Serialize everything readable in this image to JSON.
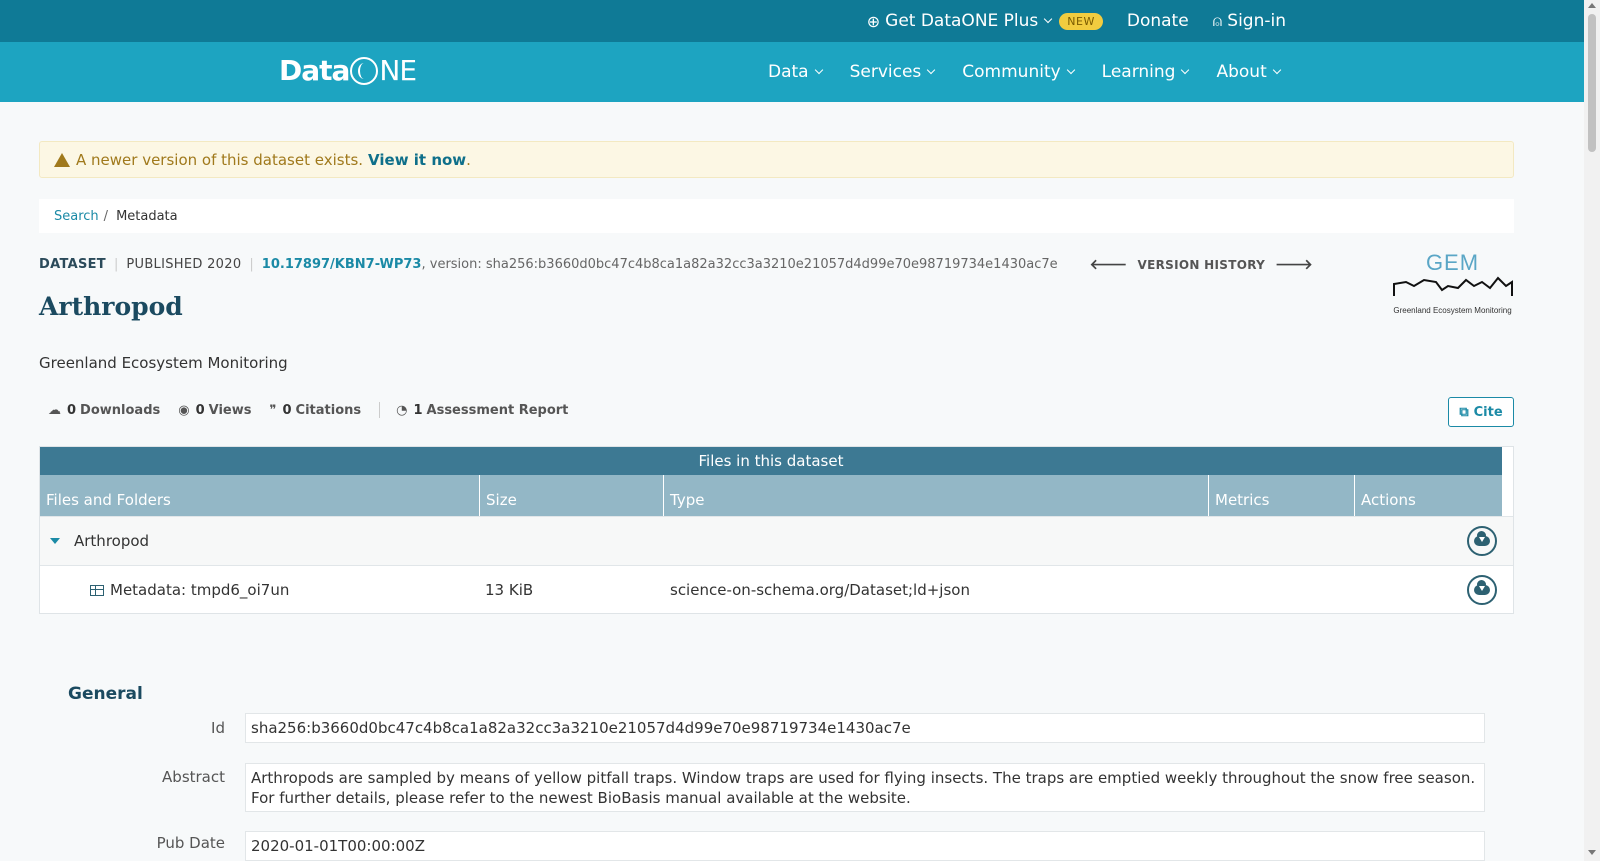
{
  "topbar": {
    "plus_label": "Get DataONE Plus",
    "plus_badge": "NEW",
    "donate_label": "Donate",
    "signin_label": "Sign-in"
  },
  "nav": {
    "logo_data": "Data",
    "logo_ne": "NE",
    "items": [
      {
        "label": "Data"
      },
      {
        "label": "Services"
      },
      {
        "label": "Community"
      },
      {
        "label": "Learning"
      },
      {
        "label": "About"
      }
    ]
  },
  "alert": {
    "text": "A newer version of this dataset exists.",
    "link": "View it now",
    "suffix": "."
  },
  "breadcrumb": {
    "search": "Search",
    "sep": "/",
    "current": "Metadata"
  },
  "dataset": {
    "type": "DATASET",
    "published": "PUBLISHED 2020",
    "doi": "10.17897/KBN7-WP73",
    "version": ", version: sha256:b3660d0bc47c4b8ca1a82a32cc3a3210e21057d4d99e70e98719734e1430ac7e",
    "version_history": "VERSION HISTORY",
    "title": "Arthropod",
    "creator": "Greenland Ecosystem Monitoring",
    "org_logo_text": "GEM",
    "org_logo_caption": "Greenland Ecosystem Monitoring"
  },
  "stats": {
    "downloads_count": "0",
    "downloads_label": "Downloads",
    "views_count": "0",
    "views_label": "Views",
    "citations_count": "0",
    "citations_label": "Citations",
    "assessment_count": "1",
    "assessment_label": "Assessment Report",
    "cite_label": "Cite"
  },
  "files": {
    "caption": "Files in this dataset",
    "columns": [
      "Files and Folders",
      "Size",
      "Type",
      "Metrics",
      "Actions"
    ],
    "folder": {
      "name": "Arthropod"
    },
    "file": {
      "name": "Metadata: tmpd6_oi7un",
      "size": "13 KiB",
      "type": "science-on-schema.org/Dataset;ld+json"
    }
  },
  "general": {
    "heading": "General",
    "id_label": "Id",
    "id_value": "sha256:b3660d0bc47c4b8ca1a82a32cc3a3210e21057d4d99e70e98719734e1430ac7e",
    "abstract_label": "Abstract",
    "abstract_value": "Arthropods are sampled by means of yellow pitfall traps. Window traps are used for flying insects. The traps are emptied weekly throughout the snow free season. For further details, please refer to the newest BioBasis manual available at the website.",
    "pubdate_label": "Pub Date",
    "pubdate_value": "2020-01-01T00:00:00Z"
  },
  "colors": {
    "topbar": "#0f7a96",
    "nav": "#1da4c1",
    "accent": "#1b8aa6",
    "table_header": "#3d7993"
  }
}
